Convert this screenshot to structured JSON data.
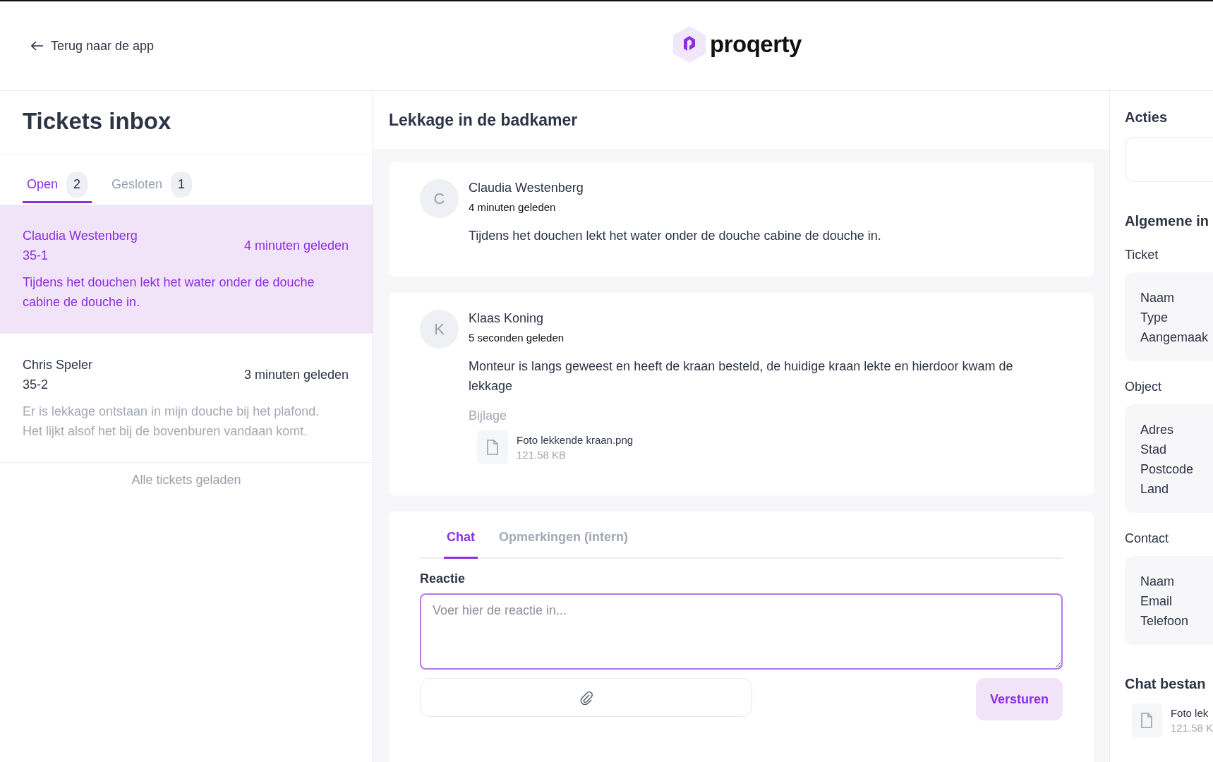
{
  "header": {
    "back_link": "Terug naar de app",
    "logo_text": "proqerty"
  },
  "inbox": {
    "title": "Tickets inbox",
    "tabs": [
      {
        "label": "Open",
        "count": "2",
        "selected": true
      },
      {
        "label": "Gesloten",
        "count": "1",
        "selected": false
      }
    ],
    "tickets": [
      {
        "name": "Claudia Westenberg",
        "number": "35-1",
        "time": "4 minuten geleden",
        "preview": "Tijdens het douchen lekt het water onder de douche cabine de douche in.",
        "selected": true
      },
      {
        "name": "Chris Speler",
        "number": "35-2",
        "time": "3 minuten geleden",
        "preview": "Er is lekkage ontstaan in mijn douche bij het plafond. Het lijkt alsof het bij de bovenburen vandaan komt.",
        "selected": false
      }
    ],
    "footer": "Alle tickets geladen"
  },
  "ticket": {
    "title": "Lekkage in de badkamer",
    "messages": [
      {
        "initial": "C",
        "author": "Claudia Westenberg",
        "time": "4 minuten geleden",
        "text": "Tijdens het douchen lekt het water onder de douche cabine de douche in."
      },
      {
        "initial": "K",
        "author": "Klaas Koning",
        "time": "5 seconden geleden",
        "text": "Monteur is langs geweest en heeft de kraan besteld, de huidige kraan lekte en hierdoor kwam de lekkage",
        "attachment_label": "Bijlage",
        "attachments": [
          {
            "name": "Foto lekkende kraan.png",
            "size": "121.58 KB"
          }
        ]
      }
    ],
    "composer": {
      "tabs": [
        {
          "label": "Chat",
          "selected": true
        },
        {
          "label": "Opmerkingen (intern)",
          "selected": false
        }
      ],
      "label": "Reactie",
      "placeholder": "Voer hier de reactie in...",
      "send_button": "Versturen"
    }
  },
  "sidebar": {
    "actions_title": "Acties",
    "info_title": "Algemene in",
    "sections": [
      {
        "title": "Ticket",
        "rows": [
          "Naam",
          "Type",
          "Aangemaak"
        ]
      },
      {
        "title": "Object",
        "rows": [
          "Adres",
          "Stad",
          "Postcode",
          "Land"
        ]
      },
      {
        "title": "Contact",
        "rows": [
          "Naam",
          "Email",
          "Telefoon"
        ]
      }
    ],
    "files_title": "Chat bestan",
    "files": [
      {
        "name": "Foto lek",
        "size": "121.58 K"
      }
    ]
  }
}
